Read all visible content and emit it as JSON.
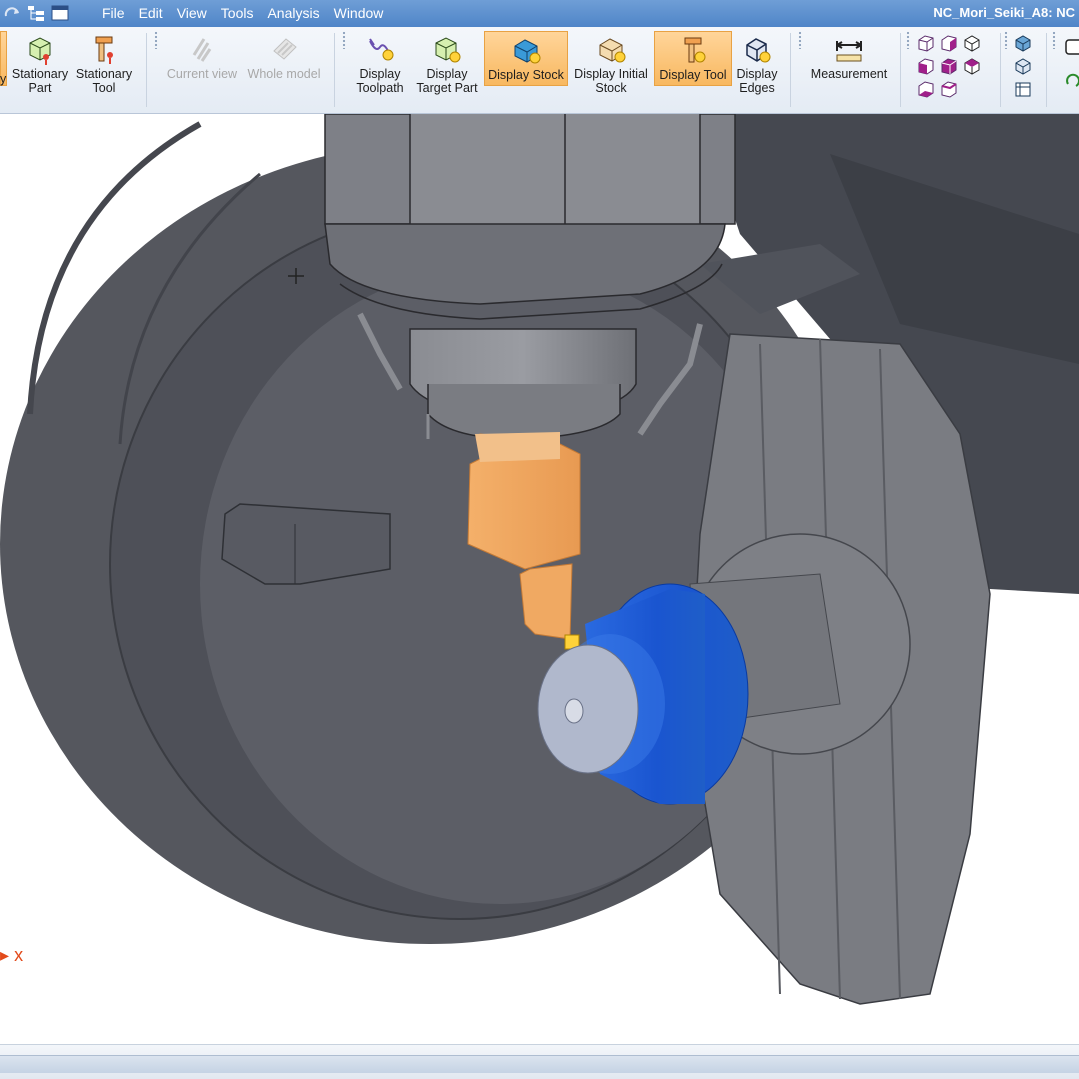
{
  "app": {
    "window_title": "NC_Mori_Seiki_A8: NC"
  },
  "menu": [
    "File",
    "Edit",
    "View",
    "Tools",
    "Analysis",
    "Window"
  ],
  "ribbon": {
    "partial_label": "y",
    "buttons": [
      {
        "label": "Stationary Part",
        "l1": "Stationary",
        "l2": "Part",
        "icon": "stationary-part-icon",
        "active": false,
        "disabled": false
      },
      {
        "label": "Stationary Tool",
        "l1": "Stationary",
        "l2": "Tool",
        "icon": "stationary-tool-icon",
        "active": false,
        "disabled": false
      },
      {
        "label": "Current view",
        "l1": "Current view",
        "l2": "",
        "icon": "current-view-icon",
        "active": false,
        "disabled": true
      },
      {
        "label": "Whole model",
        "l1": "Whole model",
        "l2": "",
        "icon": "whole-model-icon",
        "active": false,
        "disabled": true
      },
      {
        "label": "Display Toolpath",
        "l1": "Display",
        "l2": "Toolpath",
        "icon": "toolpath-icon",
        "active": false,
        "disabled": false
      },
      {
        "label": "Display Target Part",
        "l1": "Display",
        "l2": "Target Part",
        "icon": "target-part-icon",
        "active": false,
        "disabled": false
      },
      {
        "label": "Display Stock",
        "l1": "Display Stock",
        "l2": "",
        "icon": "stock-icon",
        "active": true,
        "disabled": false
      },
      {
        "label": "Display Initial Stock",
        "l1": "Display Initial",
        "l2": "Stock",
        "icon": "initial-stock-icon",
        "active": false,
        "disabled": false
      },
      {
        "label": "Display Tool",
        "l1": "Display Tool",
        "l2": "",
        "icon": "tool-icon",
        "active": true,
        "disabled": false
      },
      {
        "label": "Display Edges",
        "l1": "Display",
        "l2": "Edges",
        "icon": "edges-icon",
        "active": false,
        "disabled": false
      },
      {
        "label": "Measurement",
        "l1": "Measurement",
        "l2": "",
        "icon": "measurement-icon",
        "active": false,
        "disabled": false
      }
    ]
  },
  "viewport": {
    "axis_label": "x"
  },
  "colors": {
    "accent_active": "#f8b860",
    "stock": "#1e64e0",
    "tool": "#f0b070",
    "machine": "#5a5d66"
  }
}
